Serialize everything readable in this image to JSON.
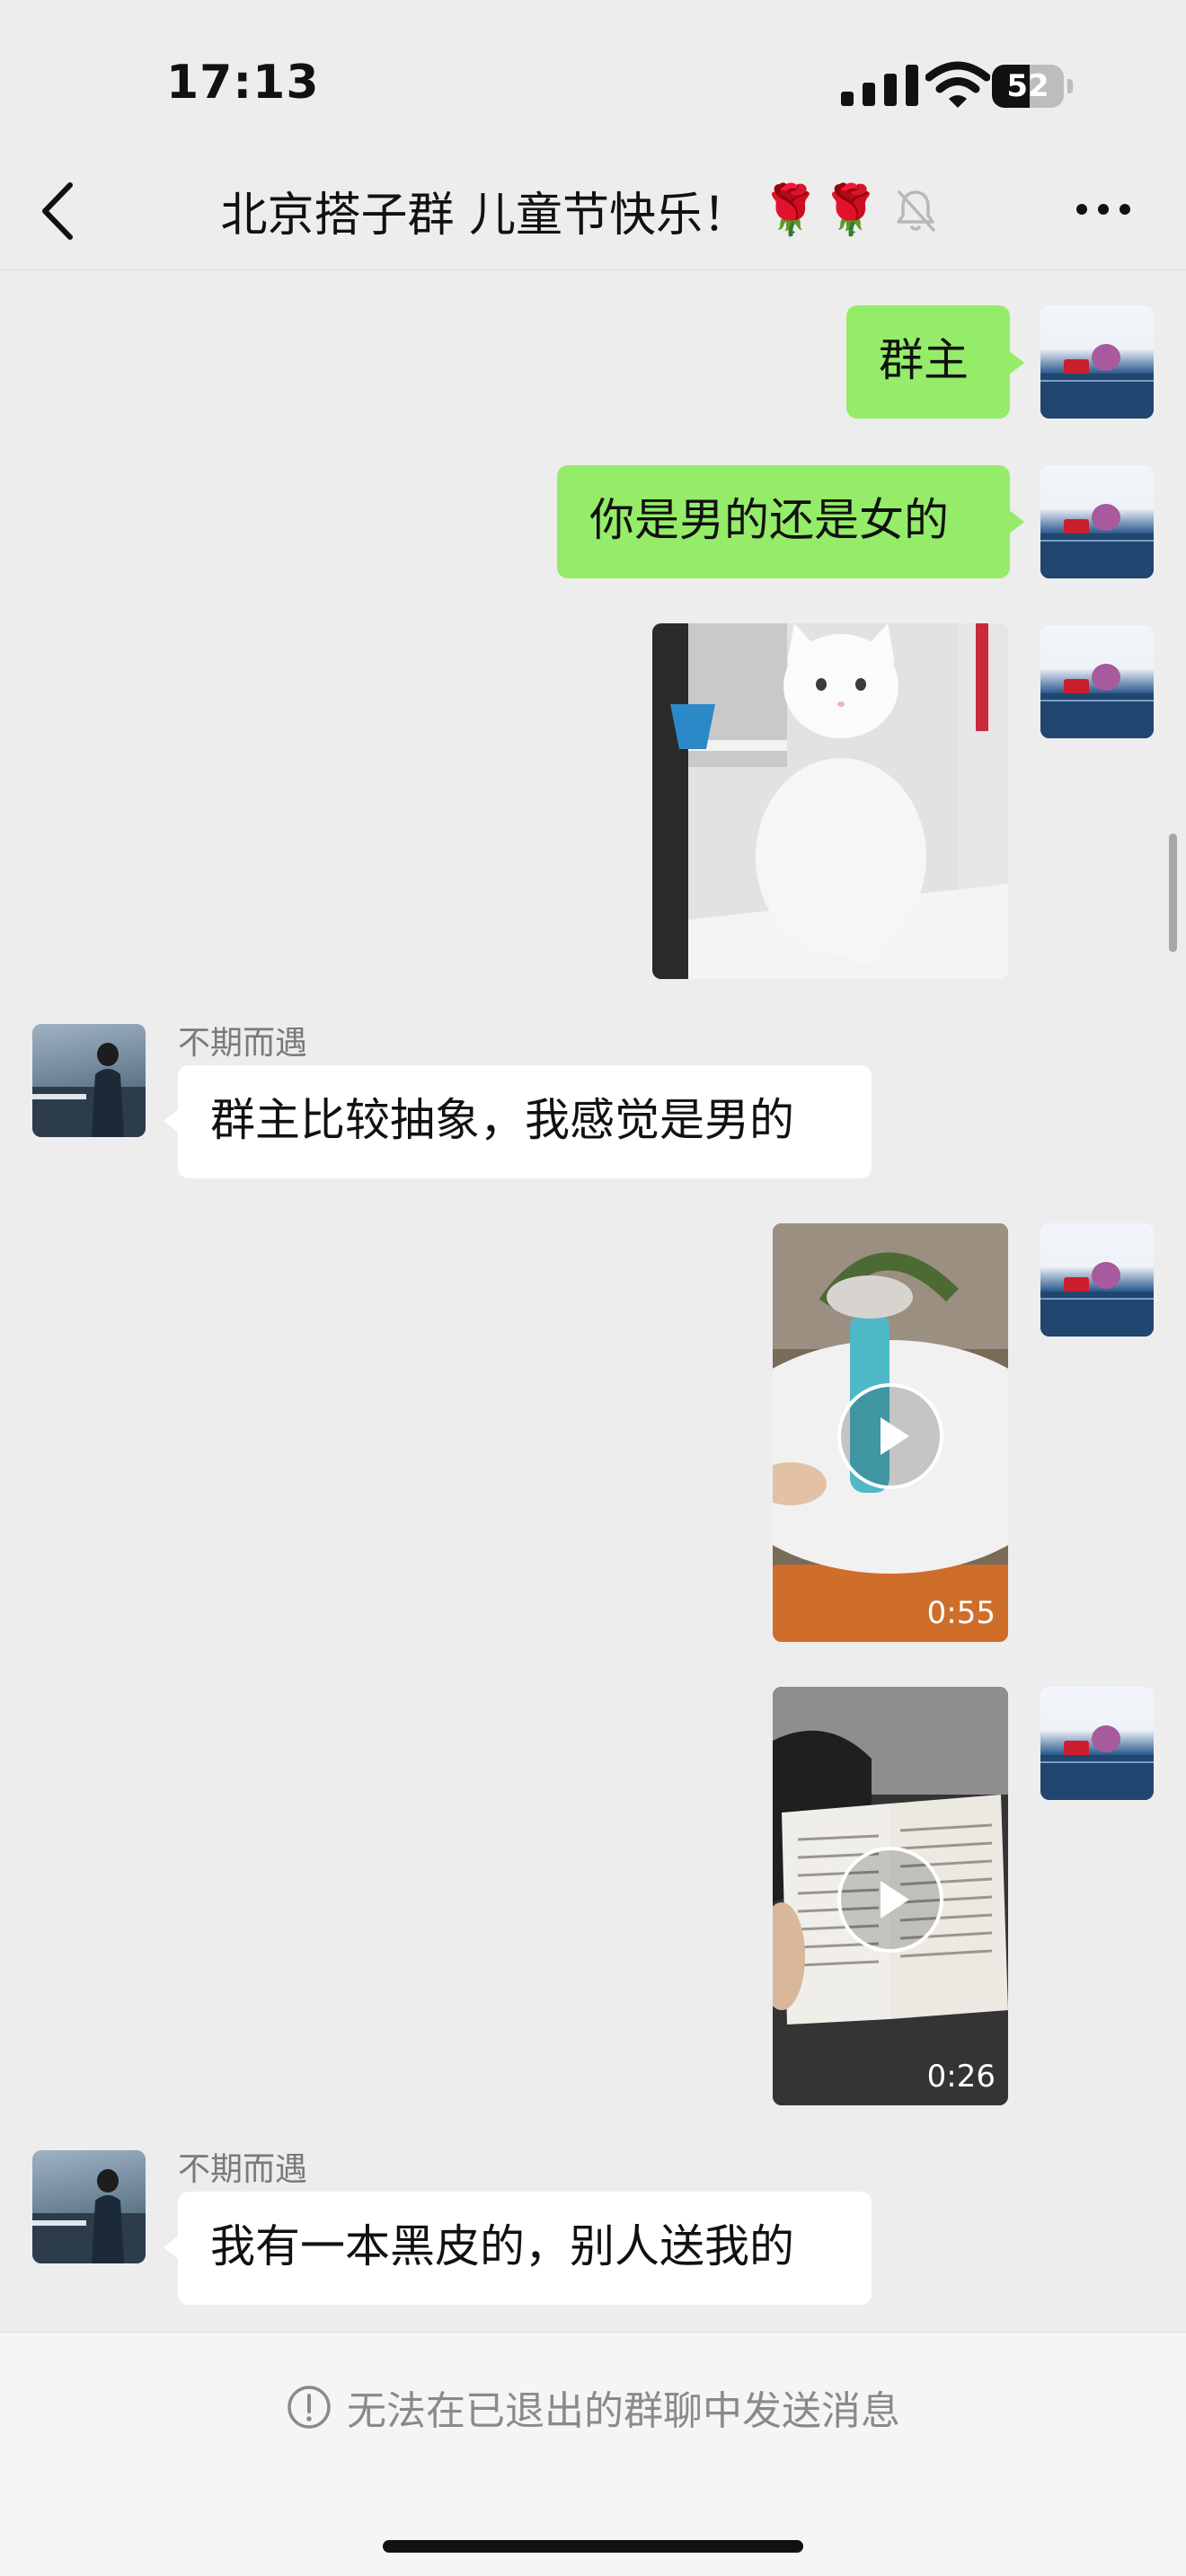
{
  "status_bar": {
    "time": "17:13",
    "battery_level": "52",
    "battery_fraction": 0.52
  },
  "header": {
    "title": "北京搭子群 儿童节快乐！",
    "title_emoji": "🌹🌹"
  },
  "messages": [
    {
      "side": "me",
      "type": "text",
      "text": "群主"
    },
    {
      "side": "me",
      "type": "text",
      "text": "你是男的还是女的"
    },
    {
      "side": "me",
      "type": "image",
      "subject": "white cat photo"
    },
    {
      "side": "other",
      "type": "text",
      "sender": "不期而遇",
      "text": "群主比较抽象，我感觉是男的"
    },
    {
      "side": "me",
      "type": "video",
      "duration": "0:55"
    },
    {
      "side": "me",
      "type": "video",
      "duration": "0:26"
    },
    {
      "side": "other",
      "type": "text",
      "sender": "不期而遇",
      "text": "我有一本黑皮的，别人送我的"
    }
  ],
  "footer": {
    "notice": "无法在已退出的群聊中发送消息"
  },
  "colors": {
    "bubble_me": "#95ec69",
    "bubble_other": "#ffffff",
    "background": "#ededed"
  },
  "icons": [
    "back-chevron-icon",
    "mute-bell-icon",
    "more-dots-icon",
    "play-icon",
    "info-circle-icon",
    "signal-icon",
    "wifi-icon",
    "battery-icon"
  ]
}
